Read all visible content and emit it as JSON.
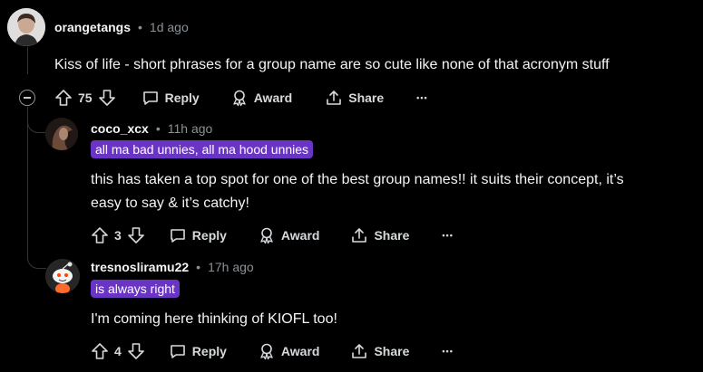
{
  "comments": [
    {
      "username": "orangetangs",
      "time": "1d ago",
      "flair": "",
      "body": "Kiss of life - short phrases for a group name are so cute like none of that acronym stuff",
      "votes": "75",
      "reply_label": "Reply",
      "award_label": "Award",
      "share_label": "Share",
      "more_label": "•••"
    },
    {
      "username": "coco_xcx",
      "time": "11h ago",
      "flair": "all ma bad unnies, all ma hood unnies",
      "body_line1": "this has taken a top spot for one of the best group names!! it suits their concept, it’s",
      "body_line2": "easy to say & it’s catchy!",
      "votes": "3",
      "reply_label": "Reply",
      "award_label": "Award",
      "share_label": "Share",
      "more_label": "•••"
    },
    {
      "username": "tresnosliramu22",
      "time": "17h ago",
      "flair": "is always right",
      "body": "I'm coming here thinking of KIOFL too!",
      "votes": "4",
      "reply_label": "Reply",
      "award_label": "Award",
      "share_label": "Share",
      "more_label": "•••"
    }
  ],
  "separator": "•",
  "colors": {
    "background": "#000000",
    "flair": "#6a35c4",
    "meta": "#8a9197"
  }
}
